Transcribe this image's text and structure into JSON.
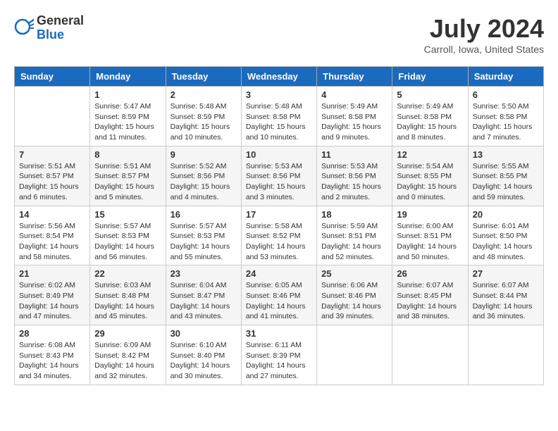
{
  "header": {
    "logo": {
      "general": "General",
      "blue": "Blue"
    },
    "title": "July 2024",
    "location": "Carroll, Iowa, United States"
  },
  "weekdays": [
    "Sunday",
    "Monday",
    "Tuesday",
    "Wednesday",
    "Thursday",
    "Friday",
    "Saturday"
  ],
  "weeks": [
    [
      {
        "day": "",
        "info": ""
      },
      {
        "day": "1",
        "info": "Sunrise: 5:47 AM\nSunset: 8:59 PM\nDaylight: 15 hours\nand 11 minutes."
      },
      {
        "day": "2",
        "info": "Sunrise: 5:48 AM\nSunset: 8:59 PM\nDaylight: 15 hours\nand 10 minutes."
      },
      {
        "day": "3",
        "info": "Sunrise: 5:48 AM\nSunset: 8:58 PM\nDaylight: 15 hours\nand 10 minutes."
      },
      {
        "day": "4",
        "info": "Sunrise: 5:49 AM\nSunset: 8:58 PM\nDaylight: 15 hours\nand 9 minutes."
      },
      {
        "day": "5",
        "info": "Sunrise: 5:49 AM\nSunset: 8:58 PM\nDaylight: 15 hours\nand 8 minutes."
      },
      {
        "day": "6",
        "info": "Sunrise: 5:50 AM\nSunset: 8:58 PM\nDaylight: 15 hours\nand 7 minutes."
      }
    ],
    [
      {
        "day": "7",
        "info": "Sunrise: 5:51 AM\nSunset: 8:57 PM\nDaylight: 15 hours\nand 6 minutes."
      },
      {
        "day": "8",
        "info": "Sunrise: 5:51 AM\nSunset: 8:57 PM\nDaylight: 15 hours\nand 5 minutes."
      },
      {
        "day": "9",
        "info": "Sunrise: 5:52 AM\nSunset: 8:56 PM\nDaylight: 15 hours\nand 4 minutes."
      },
      {
        "day": "10",
        "info": "Sunrise: 5:53 AM\nSunset: 8:56 PM\nDaylight: 15 hours\nand 3 minutes."
      },
      {
        "day": "11",
        "info": "Sunrise: 5:53 AM\nSunset: 8:56 PM\nDaylight: 15 hours\nand 2 minutes."
      },
      {
        "day": "12",
        "info": "Sunrise: 5:54 AM\nSunset: 8:55 PM\nDaylight: 15 hours\nand 0 minutes."
      },
      {
        "day": "13",
        "info": "Sunrise: 5:55 AM\nSunset: 8:55 PM\nDaylight: 14 hours\nand 59 minutes."
      }
    ],
    [
      {
        "day": "14",
        "info": "Sunrise: 5:56 AM\nSunset: 8:54 PM\nDaylight: 14 hours\nand 58 minutes."
      },
      {
        "day": "15",
        "info": "Sunrise: 5:57 AM\nSunset: 8:53 PM\nDaylight: 14 hours\nand 56 minutes."
      },
      {
        "day": "16",
        "info": "Sunrise: 5:57 AM\nSunset: 8:53 PM\nDaylight: 14 hours\nand 55 minutes."
      },
      {
        "day": "17",
        "info": "Sunrise: 5:58 AM\nSunset: 8:52 PM\nDaylight: 14 hours\nand 53 minutes."
      },
      {
        "day": "18",
        "info": "Sunrise: 5:59 AM\nSunset: 8:51 PM\nDaylight: 14 hours\nand 52 minutes."
      },
      {
        "day": "19",
        "info": "Sunrise: 6:00 AM\nSunset: 8:51 PM\nDaylight: 14 hours\nand 50 minutes."
      },
      {
        "day": "20",
        "info": "Sunrise: 6:01 AM\nSunset: 8:50 PM\nDaylight: 14 hours\nand 48 minutes."
      }
    ],
    [
      {
        "day": "21",
        "info": "Sunrise: 6:02 AM\nSunset: 8:49 PM\nDaylight: 14 hours\nand 47 minutes."
      },
      {
        "day": "22",
        "info": "Sunrise: 6:03 AM\nSunset: 8:48 PM\nDaylight: 14 hours\nand 45 minutes."
      },
      {
        "day": "23",
        "info": "Sunrise: 6:04 AM\nSunset: 8:47 PM\nDaylight: 14 hours\nand 43 minutes."
      },
      {
        "day": "24",
        "info": "Sunrise: 6:05 AM\nSunset: 8:46 PM\nDaylight: 14 hours\nand 41 minutes."
      },
      {
        "day": "25",
        "info": "Sunrise: 6:06 AM\nSunset: 8:46 PM\nDaylight: 14 hours\nand 39 minutes."
      },
      {
        "day": "26",
        "info": "Sunrise: 6:07 AM\nSunset: 8:45 PM\nDaylight: 14 hours\nand 38 minutes."
      },
      {
        "day": "27",
        "info": "Sunrise: 6:07 AM\nSunset: 8:44 PM\nDaylight: 14 hours\nand 36 minutes."
      }
    ],
    [
      {
        "day": "28",
        "info": "Sunrise: 6:08 AM\nSunset: 8:43 PM\nDaylight: 14 hours\nand 34 minutes."
      },
      {
        "day": "29",
        "info": "Sunrise: 6:09 AM\nSunset: 8:42 PM\nDaylight: 14 hours\nand 32 minutes."
      },
      {
        "day": "30",
        "info": "Sunrise: 6:10 AM\nSunset: 8:40 PM\nDaylight: 14 hours\nand 30 minutes."
      },
      {
        "day": "31",
        "info": "Sunrise: 6:11 AM\nSunset: 8:39 PM\nDaylight: 14 hours\nand 27 minutes."
      },
      {
        "day": "",
        "info": ""
      },
      {
        "day": "",
        "info": ""
      },
      {
        "day": "",
        "info": ""
      }
    ]
  ]
}
